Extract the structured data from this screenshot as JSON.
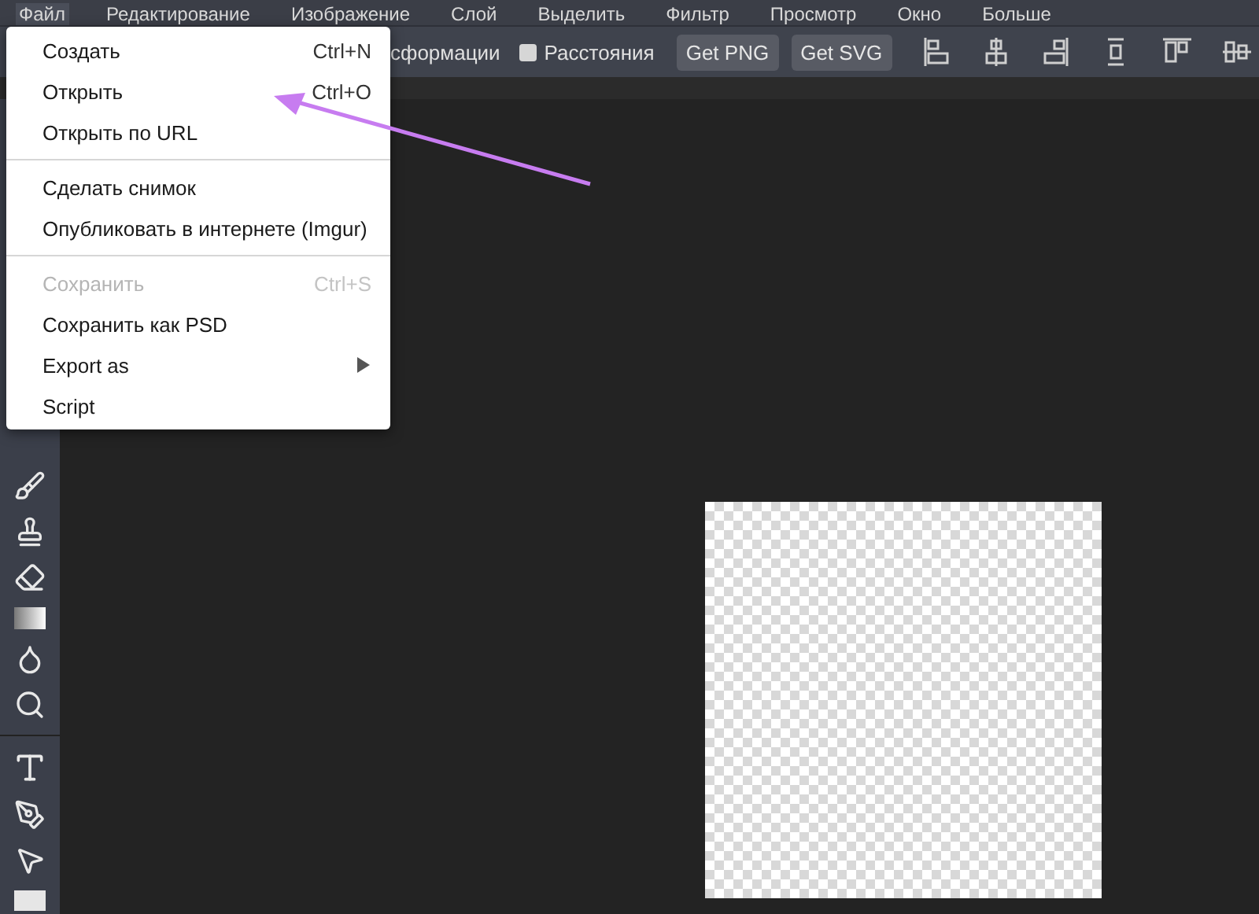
{
  "menubar": [
    {
      "label": "Файл",
      "selected": true
    },
    {
      "label": "Редактирование",
      "selected": false
    },
    {
      "label": "Изображение",
      "selected": false
    },
    {
      "label": "Слой",
      "selected": false
    },
    {
      "label": "Выделить",
      "selected": false
    },
    {
      "label": "Фильтр",
      "selected": false
    },
    {
      "label": "Просмотр",
      "selected": false
    },
    {
      "label": "Окно",
      "selected": false
    },
    {
      "label": "Больше",
      "selected": false
    }
  ],
  "options_bar": {
    "transform_label": "сформации",
    "distances": {
      "label": "Расстояния",
      "checked": false
    },
    "buttons": [
      "Get PNG",
      "Get SVG"
    ]
  },
  "file_menu": [
    {
      "kind": "item",
      "label": "Создать",
      "shortcut": "Ctrl+N",
      "disabled": false
    },
    {
      "kind": "item",
      "label": "Открыть",
      "shortcut": "Ctrl+O",
      "disabled": false
    },
    {
      "kind": "item",
      "label": "Открыть по URL",
      "disabled": false
    },
    {
      "kind": "separator"
    },
    {
      "kind": "item",
      "label": "Сделать снимок",
      "disabled": false
    },
    {
      "kind": "item",
      "label": "Опубликовать в интернете (Imgur)",
      "disabled": false
    },
    {
      "kind": "separator"
    },
    {
      "kind": "item",
      "label": "Сохранить",
      "shortcut": "Ctrl+S",
      "disabled": true
    },
    {
      "kind": "item",
      "label": "Сохранить как PSD",
      "disabled": false
    },
    {
      "kind": "submenu",
      "label": "Export as",
      "disabled": false
    },
    {
      "kind": "item",
      "label": "Script",
      "disabled": false
    }
  ]
}
